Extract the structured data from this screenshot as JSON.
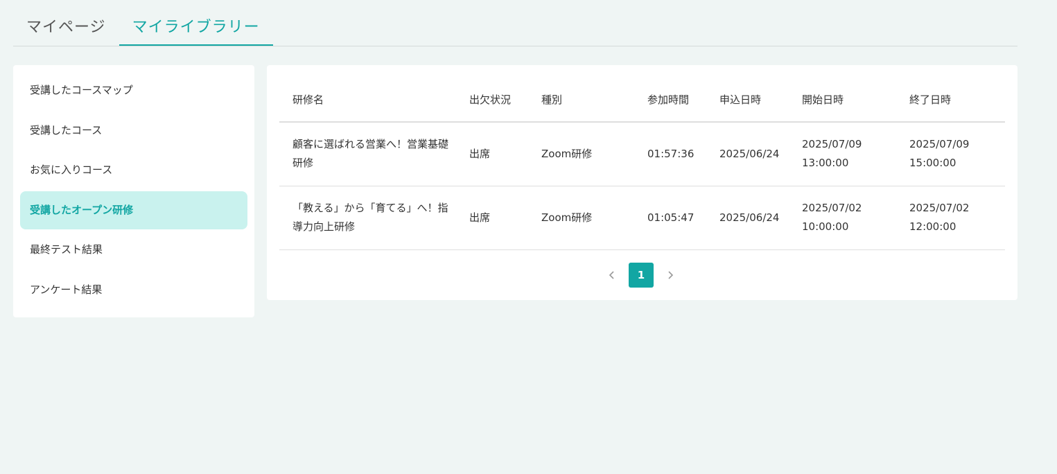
{
  "tabs": [
    {
      "label": "マイページ",
      "active": false
    },
    {
      "label": "マイライブラリー",
      "active": true
    }
  ],
  "sidebar": {
    "items": [
      {
        "label": "受講したコースマップ"
      },
      {
        "label": "受講したコース"
      },
      {
        "label": "お気に入りコース"
      },
      {
        "label": "受講したオープン研修",
        "active": true
      },
      {
        "label": "最終テスト結果"
      },
      {
        "label": "アンケート結果"
      }
    ]
  },
  "table": {
    "headers": [
      "研修名",
      "出欠状況",
      "種別",
      "参加時間",
      "申込日時",
      "開始日時",
      "終了日時"
    ],
    "rows": [
      {
        "name": "顧客に選ばれる営業へ！営業基礎研修",
        "attendance": "出席",
        "type": "Zoom研修",
        "duration": "01:57:36",
        "applied": "2025/06/24",
        "start_date": "2025/07/09",
        "start_time": "13:00:00",
        "end_date": "2025/07/09",
        "end_time": "15:00:00"
      },
      {
        "name": "「教える」から「育てる」へ！指導力向上研修",
        "attendance": "出席",
        "type": "Zoom研修",
        "duration": "01:05:47",
        "applied": "2025/06/24",
        "start_date": "2025/07/02",
        "start_time": "10:00:00",
        "end_date": "2025/07/02",
        "end_time": "12:00:00"
      }
    ]
  },
  "pagination": {
    "current": "1",
    "prev_icon": "chevron-left-icon",
    "next_icon": "chevron-right-icon"
  },
  "colors": {
    "accent": "#12a6a3",
    "active_bg": "#c9f2ee",
    "background": "#eff5f4"
  }
}
